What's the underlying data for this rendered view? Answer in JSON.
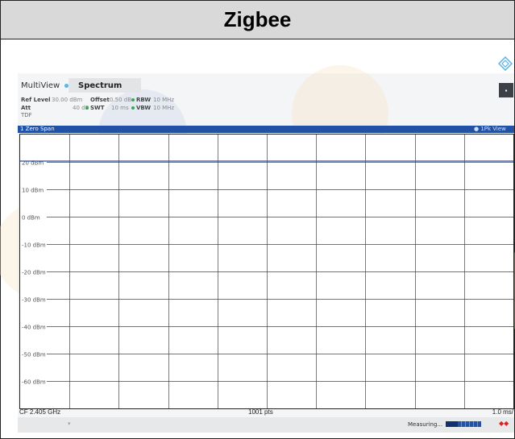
{
  "header": {
    "title": "Zigbee"
  },
  "tabs": [
    {
      "label": "MultiView"
    },
    {
      "label": "Spectrum"
    }
  ],
  "corner_button": {
    "icon": "menu-dot-icon",
    "glyph": "▪"
  },
  "params": {
    "ref_level_key": "Ref Level",
    "ref_level_val": "30.00 dBm",
    "offset_key": "Offset",
    "offset_val": "0.50 dB",
    "rbw_key": "RBW",
    "rbw_val": "10 MHz",
    "att_key": "Att",
    "att_val": "40 dB",
    "swt_key": "SWT",
    "swt_val": "10 ms",
    "vbw_key": "VBW",
    "vbw_val": "10 MHz",
    "tdf": "TDF"
  },
  "window": {
    "title": "1 Zero Span",
    "right_label": "1Pk View",
    "right_dot": "●"
  },
  "bottom": {
    "center_freq": "CF 2.405 GHz",
    "points": "1001 pts",
    "time_div": "1.0 ms/"
  },
  "status": {
    "text": "Measuring...",
    "progress": 0.35,
    "icon": "signal-error-icon",
    "icon_glyph": "◆◆",
    "arrow_glyph": "▾"
  },
  "colors": {
    "trace": "#2252a6",
    "window_bar": "#2252a6",
    "header_bg": "#d9d9d9"
  },
  "chart_data": {
    "type": "line",
    "y_unit": "dBm",
    "y_ticks": [
      "20 dBm",
      "10 dBm",
      "0 dBm",
      "-10 dBm",
      "-20 dBm",
      "-30 dBm",
      "-40 dBm",
      "-50 dBm",
      "-60 dBm"
    ],
    "ylim": [
      -70,
      30
    ],
    "xlim": [
      0,
      10
    ],
    "x_unit": "ms",
    "x_divisions": 10,
    "grid": true,
    "series": [
      {
        "x": [
          0,
          1,
          2,
          3,
          4,
          5,
          6,
          7,
          8,
          9,
          10
        ],
        "y": [
          20.3,
          20.3,
          20.3,
          20.3,
          20.3,
          20.3,
          20.3,
          20.3,
          20.3,
          20.3,
          20.3
        ]
      }
    ]
  }
}
